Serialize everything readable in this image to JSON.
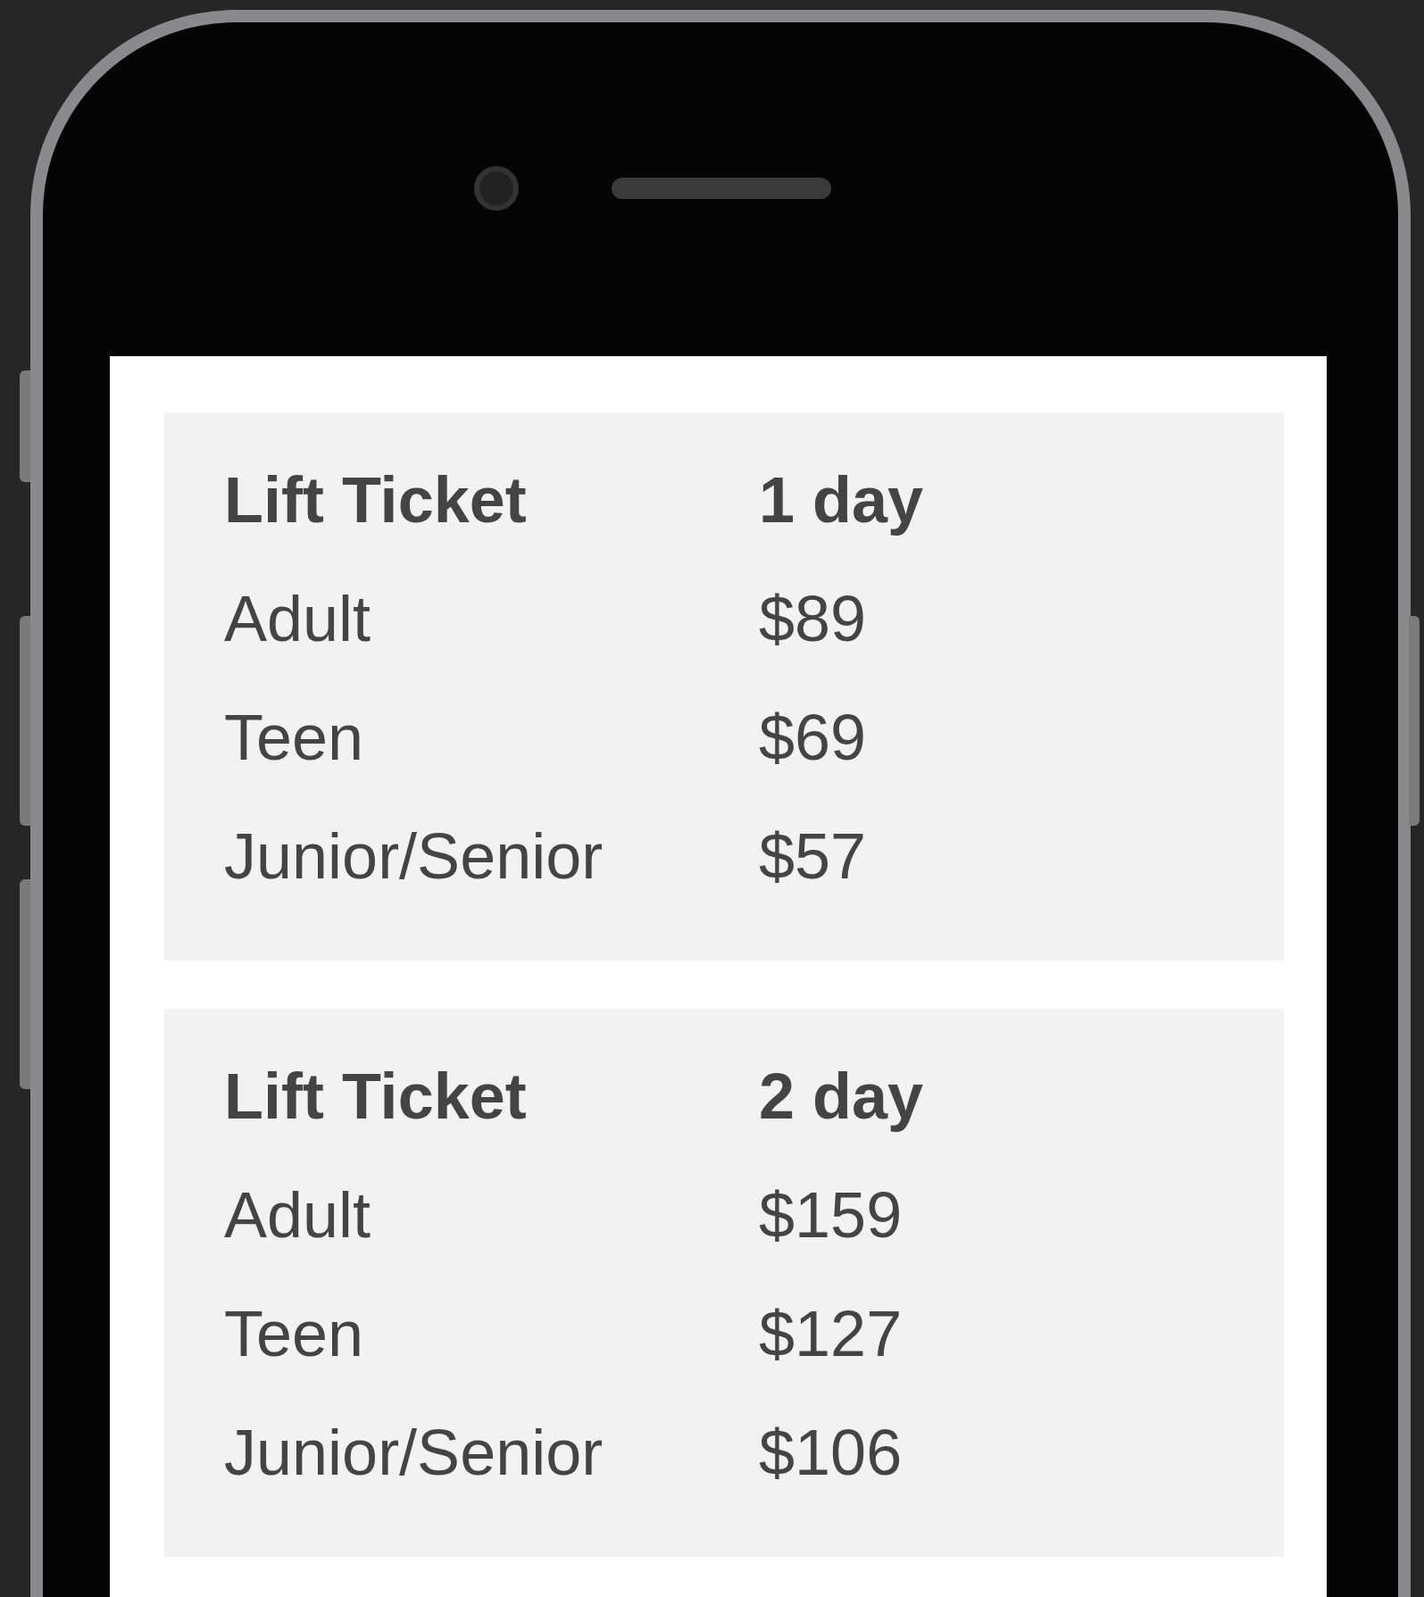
{
  "tables": [
    {
      "header": [
        "Lift Ticket",
        "1 day"
      ],
      "rows": [
        [
          "Adult",
          "$89"
        ],
        [
          "Teen",
          "$69"
        ],
        [
          "Junior/Senior",
          "$57"
        ]
      ]
    },
    {
      "header": [
        "Lift Ticket",
        "2 day"
      ],
      "rows": [
        [
          "Adult",
          "$159"
        ],
        [
          "Teen",
          "$127"
        ],
        [
          "Junior/Senior",
          "$106"
        ]
      ]
    }
  ]
}
